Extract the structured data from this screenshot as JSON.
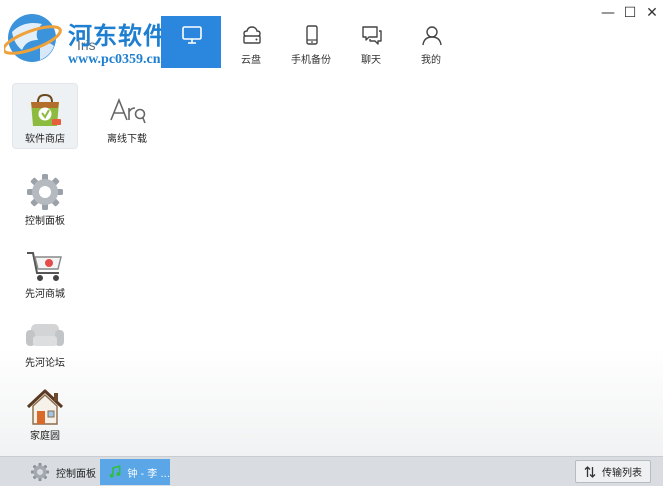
{
  "window": {
    "minimize_glyph": "—",
    "maximize_glyph": "☐",
    "close_glyph": "✕"
  },
  "brand": {
    "watermark_cn": "河东软件园",
    "watermark_url": "www.pc0359.cn",
    "product": "Iris"
  },
  "nav": [
    {
      "label": "",
      "icon": "desktop-icon",
      "active": true
    },
    {
      "label": "云盘",
      "icon": "cloud-drive-icon"
    },
    {
      "label": "手机备份",
      "icon": "phone-icon"
    },
    {
      "label": "聊天",
      "icon": "chat-icon"
    },
    {
      "label": "我的",
      "icon": "user-icon"
    }
  ],
  "apps": [
    {
      "label": "软件商店",
      "icon": "software-store-icon",
      "selected": true
    },
    {
      "label": "离线下载",
      "icon": "offline-download-icon"
    },
    {
      "label": "控制面板",
      "icon": "gear-icon"
    },
    {
      "label": "先河商城",
      "icon": "shopping-cart-icon"
    },
    {
      "label": "先河论坛",
      "icon": "sofa-icon"
    },
    {
      "label": "家庭圆",
      "icon": "house-icon"
    }
  ],
  "taskbar": {
    "control_panel": "控制面板",
    "music": "钟 - 李 ...",
    "transfer_list": "传输列表"
  },
  "colors": {
    "accent": "#2b86dd",
    "music_task": "#5aa6e6",
    "taskbar": "#d9dde2"
  }
}
